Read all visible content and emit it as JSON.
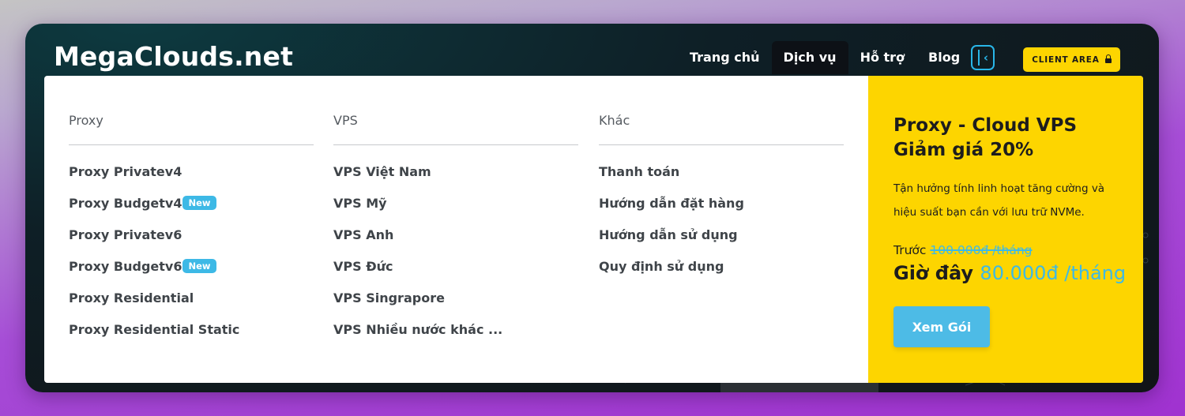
{
  "header": {
    "logo": "MegaClouds.net",
    "nav": [
      {
        "label": "Trang chủ"
      },
      {
        "label": "Dịch vụ",
        "active": true
      },
      {
        "label": "Hỗ trợ"
      },
      {
        "label": "Blog"
      }
    ],
    "toggle_icon": "panel-collapse-icon",
    "client_area_label": "CLIENT AREA",
    "lock_icon": "lock-icon"
  },
  "menu": {
    "proxy": {
      "title": "Proxy",
      "items": [
        {
          "label": "Proxy Privatev4",
          "badge": ""
        },
        {
          "label": "Proxy Budgetv4",
          "badge": "New"
        },
        {
          "label": "Proxy Privatev6",
          "badge": ""
        },
        {
          "label": "Proxy Budgetv6",
          "badge": "New"
        },
        {
          "label": "Proxy Residential",
          "badge": ""
        },
        {
          "label": "Proxy Residential Static",
          "badge": ""
        }
      ]
    },
    "vps": {
      "title": "VPS",
      "items": [
        {
          "label": "VPS Việt Nam"
        },
        {
          "label": "VPS Mỹ"
        },
        {
          "label": "VPS Anh"
        },
        {
          "label": "VPS Đức"
        },
        {
          "label": "VPS Singrapore"
        },
        {
          "label": "VPS Nhiều nước khác ..."
        }
      ]
    },
    "other": {
      "title": "Khác",
      "items": [
        {
          "label": "Thanh toán"
        },
        {
          "label": "Hướng dẫn đặt hàng"
        },
        {
          "label": "Hướng dẫn sử dụng"
        },
        {
          "label": "Quy định sử dụng"
        }
      ]
    }
  },
  "promo": {
    "title_line1": "Proxy - Cloud VPS",
    "title_line2": "Giảm giá 20%",
    "description": "Tận hưởng tính linh hoạt tăng cường và hiệu suất bạn cần với lưu trữ NVMe.",
    "before_label": "Trước",
    "old_price": "100.000đ /tháng",
    "now_label": "Giờ đây",
    "new_price": "80.000đ /tháng",
    "cta_label": "Xem Gói"
  },
  "colors": {
    "accent_yellow": "#fdd500",
    "accent_blue": "#3db9e6",
    "header_bg": "#0e1f26"
  }
}
